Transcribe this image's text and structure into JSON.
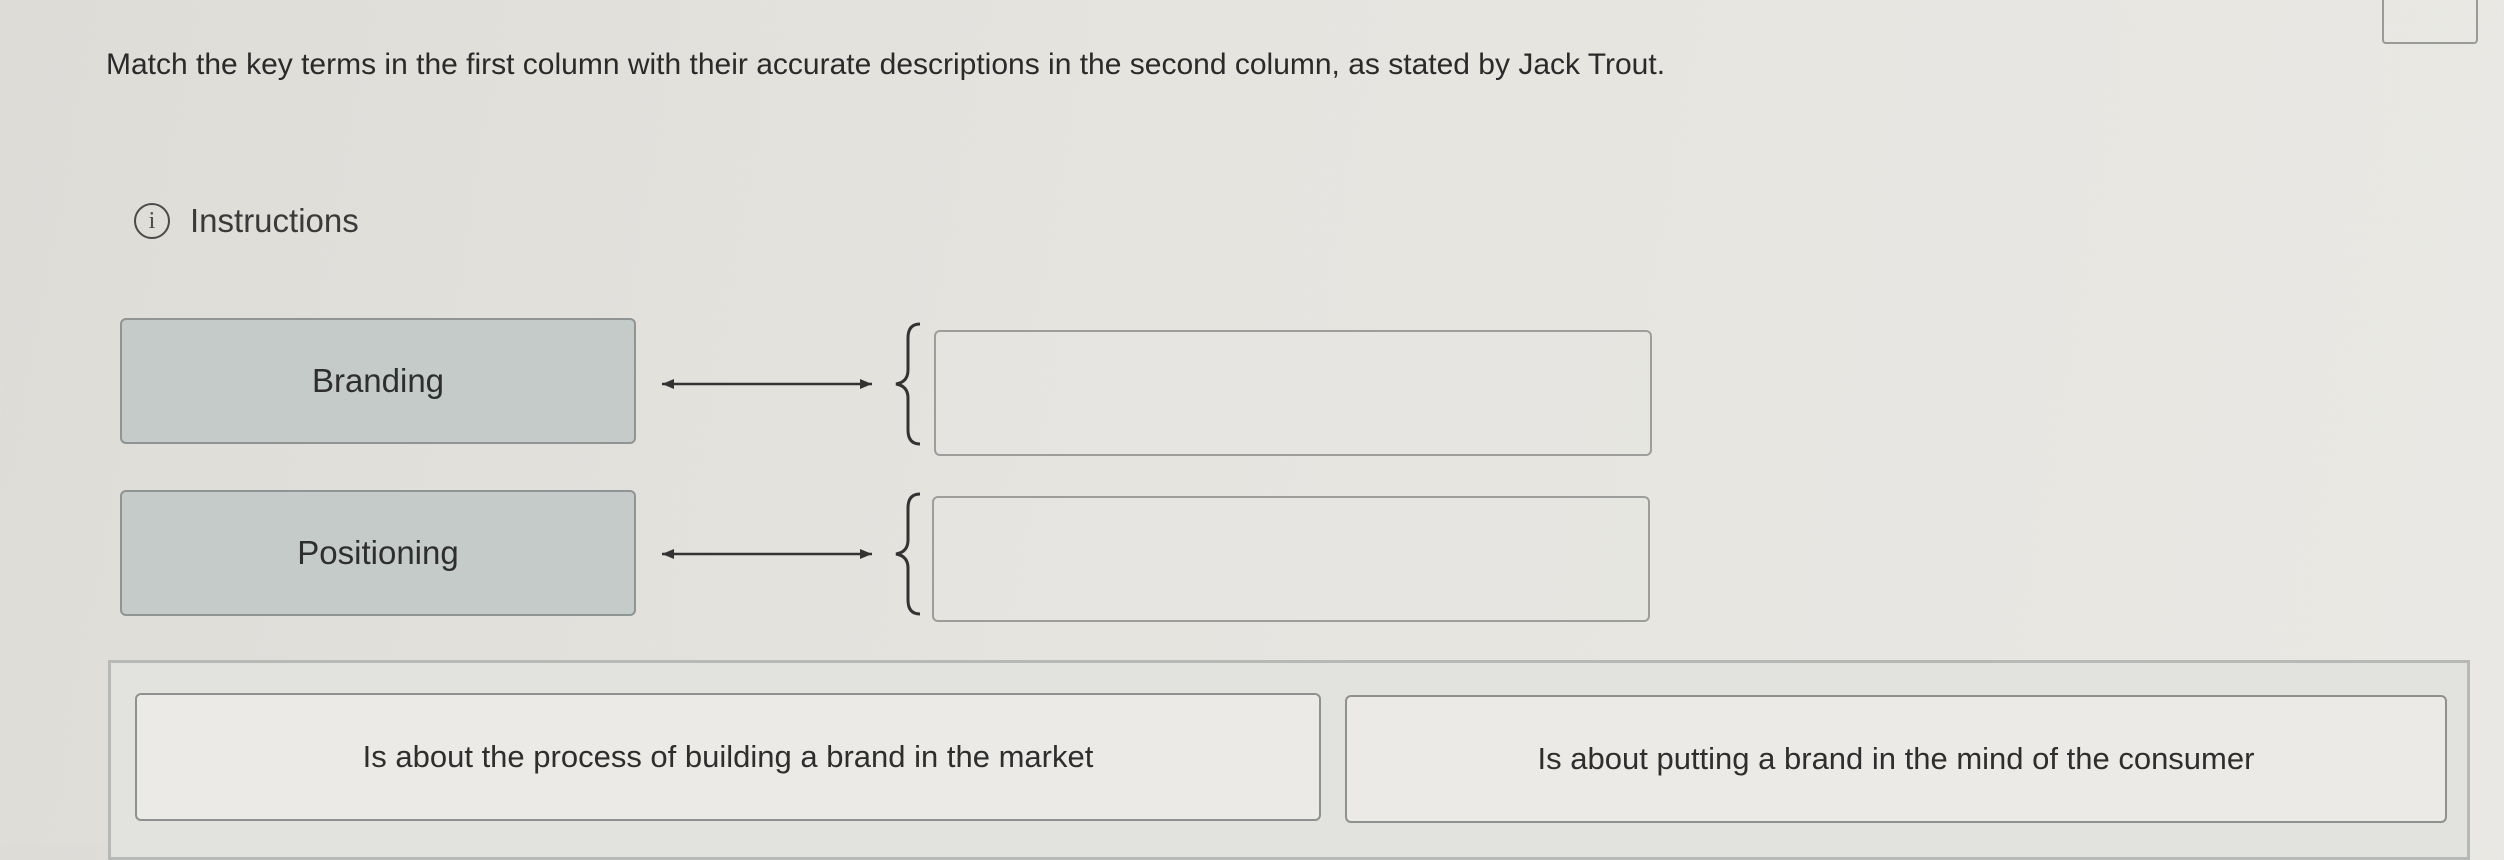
{
  "prompt": "Match the key terms in the first column with their accurate descriptions in the second column, as stated by Jack Trout.",
  "instructions": {
    "icon": "info-icon",
    "icon_glyph": "i",
    "label": "Instructions"
  },
  "terms": [
    {
      "label": "Branding"
    },
    {
      "label": "Positioning"
    }
  ],
  "descriptions": [
    {
      "label": "Is about the process of building a brand in the market"
    },
    {
      "label": "Is about putting a brand in the mind of the consumer"
    }
  ]
}
